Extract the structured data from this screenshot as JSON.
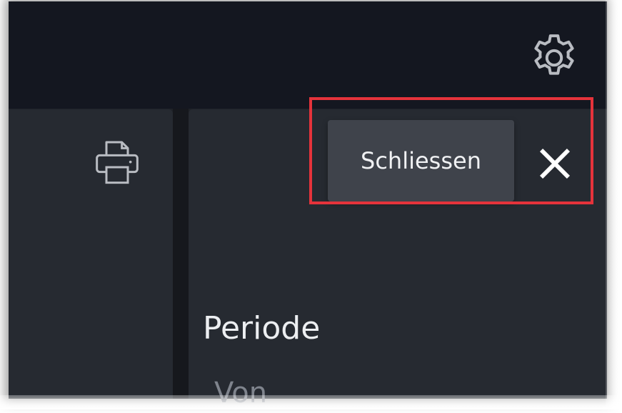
{
  "header": {
    "settings_icon": "gear-icon"
  },
  "toolbar": {
    "print_icon": "printer-icon"
  },
  "dialog": {
    "close_tooltip": "Schliessen",
    "close_icon": "close-icon"
  },
  "form": {
    "section_title": "Periode",
    "from_label": "Von"
  },
  "colors": {
    "header_bg": "#141720",
    "panel_bg": "#262a31",
    "tooltip_bg": "#3f434b",
    "highlight": "#e5333b"
  }
}
